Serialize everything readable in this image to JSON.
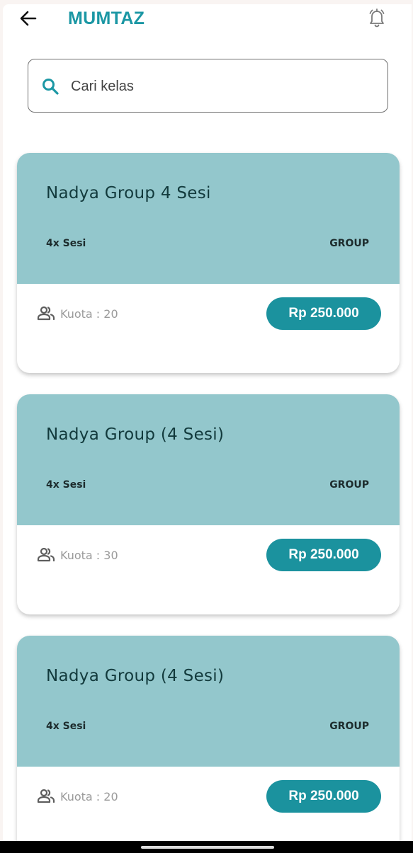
{
  "header": {
    "title": "MUMTAZ",
    "back_icon": "arrow-left-icon",
    "bell_icon": "bell-ringing-icon"
  },
  "search": {
    "placeholder": "Cari kelas",
    "value": "",
    "icon": "search-icon"
  },
  "colors": {
    "brand": "#1b97a4",
    "card_header": "#93c7cc",
    "price_button": "#1b929e"
  },
  "classes": [
    {
      "title": "Nadya Group 4 Sesi",
      "sessions": "4x Sesi",
      "type": "GROUP",
      "quota": "Kuota : 20",
      "price": "Rp 250.000"
    },
    {
      "title": "Nadya Group (4 Sesi)",
      "sessions": "4x Sesi",
      "type": "GROUP",
      "quota": "Kuota : 30",
      "price": "Rp 250.000"
    },
    {
      "title": "Nadya Group (4 Sesi)",
      "sessions": "4x Sesi",
      "type": "GROUP",
      "quota": "Kuota : 20",
      "price": "Rp 250.000"
    }
  ]
}
